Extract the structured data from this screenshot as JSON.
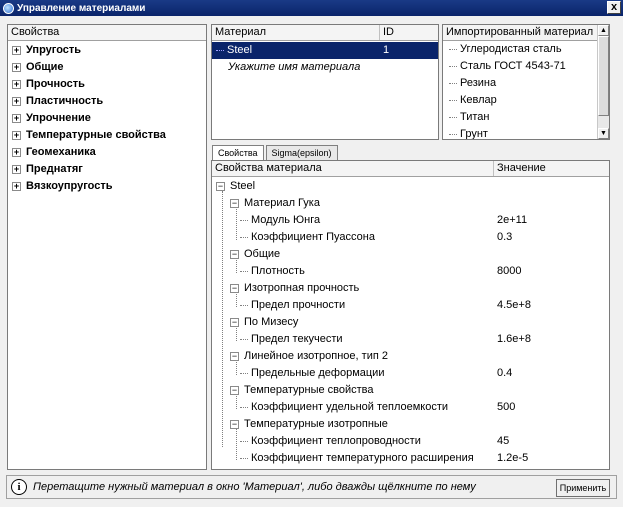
{
  "window": {
    "title": "Управление материалами",
    "close_glyph": "x"
  },
  "properties_panel": {
    "header": "Свойства",
    "items": [
      "Упругость",
      "Общие",
      "Прочность",
      "Пластичность",
      "Упрочнение",
      "Температурные свойства",
      "Геомеханика",
      "Преднатяг",
      "Вязкоупругость"
    ]
  },
  "materials_panel": {
    "col_material": "Материал",
    "col_id": "ID",
    "rows": [
      {
        "name": "Steel",
        "id": "1"
      }
    ],
    "placeholder": "Укажите имя материала"
  },
  "imported_panel": {
    "header": "Импортированный материал",
    "items": [
      "Углеродистая сталь",
      "Сталь ГОСТ 4543-71",
      "Резина",
      "Кевлар",
      "Титан",
      "Грунт"
    ]
  },
  "tabs": [
    {
      "label": "Свойства"
    },
    {
      "label": "Sigma(epsilon)"
    }
  ],
  "prop_table": {
    "col_name": "Свойства материала",
    "col_value": "Значение",
    "rows": [
      {
        "label": "Steel",
        "value": ""
      },
      {
        "label": "Материал Гука",
        "value": ""
      },
      {
        "label": "Модуль Юнга",
        "value": "2e+11"
      },
      {
        "label": "Коэффициент Пуассона",
        "value": "0.3"
      },
      {
        "label": "Общие",
        "value": ""
      },
      {
        "label": "Плотность",
        "value": "8000"
      },
      {
        "label": "Изотропная прочность",
        "value": ""
      },
      {
        "label": "Предел прочности",
        "value": "4.5e+8"
      },
      {
        "label": "По Мизесу",
        "value": ""
      },
      {
        "label": "Предел текучести",
        "value": "1.6e+8"
      },
      {
        "label": "Линейное изотропное, тип 2",
        "value": ""
      },
      {
        "label": "Предельные деформации",
        "value": "0.4"
      },
      {
        "label": "Температурные свойства",
        "value": ""
      },
      {
        "label": "Коэффициент удельной теплоемкости",
        "value": "500"
      },
      {
        "label": "Температурные изотропные",
        "value": ""
      },
      {
        "label": "Коэффициент теплопроводности",
        "value": "45"
      },
      {
        "label": "Коэффициент температурного расширения",
        "value": "1.2e-5"
      }
    ]
  },
  "status": {
    "info_glyph": "i",
    "text": "Перетащите нужный материал в окно 'Материал', либо дважды щёлкните по нему",
    "apply_label": "Применить"
  }
}
